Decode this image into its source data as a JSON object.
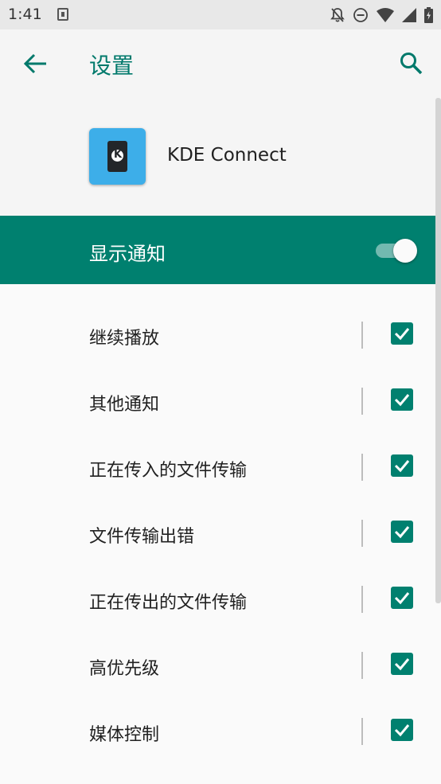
{
  "status_bar": {
    "time": "1:41",
    "icons": [
      "notification-app-icon",
      "bell-off-icon",
      "do-not-disturb-icon",
      "wifi-icon",
      "signal-icon",
      "battery-charging-icon"
    ]
  },
  "app_bar": {
    "title": "设置",
    "back_icon": "arrow-left-icon",
    "search_icon": "search-icon"
  },
  "app_info": {
    "name": "KDE Connect",
    "icon_color": "#3daee9"
  },
  "master_switch": {
    "label": "显示通知",
    "on": true,
    "background": "#00806f"
  },
  "channels": [
    {
      "label": "继续播放",
      "checked": true
    },
    {
      "label": "其他通知",
      "checked": true
    },
    {
      "label": "正在传入的文件传输",
      "checked": true
    },
    {
      "label": "文件传输出错",
      "checked": true
    },
    {
      "label": "正在传出的文件传输",
      "checked": true
    },
    {
      "label": "高优先级",
      "checked": true
    },
    {
      "label": "媒体控制",
      "checked": true
    }
  ],
  "colors": {
    "accent": "#00796b",
    "checkbox": "#00806f"
  }
}
